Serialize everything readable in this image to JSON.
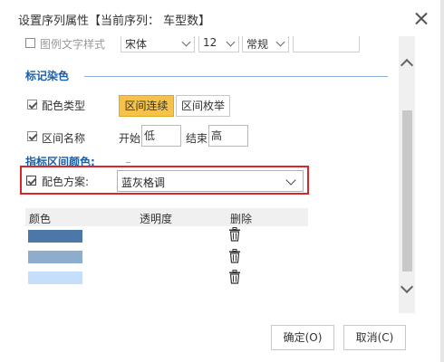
{
  "dialog": {
    "title": "设置序列属性【当前序列： 车型数】"
  },
  "top_row": {
    "label": "图例文字样式",
    "font": "宋体",
    "size": "12",
    "style": "常规"
  },
  "marker_color": {
    "section_title": "标记染色",
    "color_type_label": "配色类型",
    "btn_range_continuous": "区间连续",
    "btn_range_enum": "区间枚举",
    "range_name_label": "区间名称",
    "start_label": "开始",
    "start_value": "低",
    "end_label": "结束",
    "end_value": "高"
  },
  "indicator": {
    "section_title": "指标区间颜色:",
    "scheme_label": "配色方案:",
    "scheme_value": "蓝灰格调"
  },
  "table": {
    "headers": [
      "颜色",
      "透明度",
      "删除"
    ],
    "rows": [
      {
        "color": "#4c78a8"
      },
      {
        "color": "#8eaccd"
      },
      {
        "color": "#c5def9"
      }
    ]
  },
  "footer": {
    "ok": "确定(O)",
    "cancel": "取消(C)"
  }
}
